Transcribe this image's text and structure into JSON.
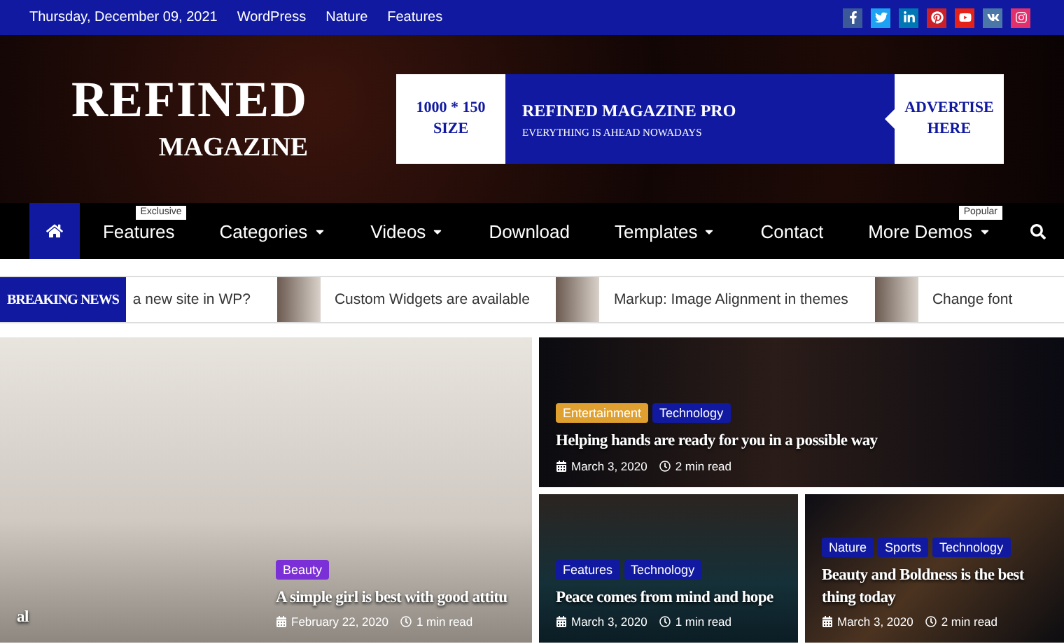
{
  "top_bar": {
    "date": "Thursday, December 09, 2021",
    "links": [
      "WordPress",
      "Nature",
      "Features"
    ],
    "social": [
      {
        "kind": "facebook",
        "color": "#3b5998"
      },
      {
        "kind": "twitter",
        "color": "#1da1f2"
      },
      {
        "kind": "linkedin",
        "color": "#0077b5"
      },
      {
        "kind": "pinterest",
        "color": "#cb2027"
      },
      {
        "kind": "youtube",
        "color": "#e62117"
      },
      {
        "kind": "vk",
        "color": "#4a76a8"
      },
      {
        "kind": "instagram",
        "color": "#e1306c"
      }
    ]
  },
  "logo": {
    "line_1": "REFINED",
    "line_2": "MAGAZINE"
  },
  "ad_banner": {
    "size_lines": [
      "1000 * 150",
      "SIZE"
    ],
    "title": "REFINED MAGAZINE PRO",
    "subtitle": "EVERYTHING IS AHEAD NOWADAYS",
    "cta_lines": [
      "ADVERTISE",
      "HERE"
    ]
  },
  "nav": {
    "items": [
      {
        "kind": "home",
        "selected": true
      },
      {
        "kind": "link",
        "label": "Features",
        "dropdown": false,
        "badge": "Exclusive",
        "selected": false
      },
      {
        "kind": "link",
        "label": "Categories",
        "dropdown": true,
        "selected": false
      },
      {
        "kind": "link",
        "label": "Videos",
        "dropdown": true,
        "selected": false
      },
      {
        "kind": "link",
        "label": "Download",
        "dropdown": false,
        "selected": false
      },
      {
        "kind": "link",
        "label": "Templates",
        "dropdown": true,
        "selected": false
      },
      {
        "kind": "link",
        "label": "Contact",
        "dropdown": false,
        "selected": false
      },
      {
        "kind": "link",
        "label": "More Demos",
        "dropdown": true,
        "badge": "Popular",
        "selected": false
      }
    ]
  },
  "breaking_news": {
    "label": "BREAKING NEWS",
    "items": [
      {
        "title": "a new site in WP?",
        "thumbnail": false
      },
      {
        "title": "Custom Widgets are available",
        "thumbnail": true
      },
      {
        "title": "Markup: Image Alignment in themes",
        "thumbnail": true
      },
      {
        "title": "Change font",
        "thumbnail": true
      }
    ]
  },
  "slider": [
    {
      "title": "al"
    },
    {
      "title": "A simple girl is best with good attitu",
      "tags": [
        {
          "label": "Beauty",
          "color": "#7b2fd6"
        }
      ],
      "date": "February 22, 2020",
      "read_time": "1 min read"
    }
  ],
  "featured": [
    {
      "title": "Helping hands are ready for you in a possible way",
      "tags": [
        {
          "label": "Entertainment",
          "color": "#e0a030"
        },
        {
          "label": "Technology",
          "color": "#1019a0"
        }
      ],
      "date": "March 3, 2020",
      "read_time": "2 min read"
    },
    {
      "title": "Peace comes from mind and hope",
      "tags": [
        {
          "label": "Features",
          "color": "#1019a0"
        },
        {
          "label": "Technology",
          "color": "#1019a0"
        }
      ],
      "date": "March 3, 2020",
      "read_time": "1 min read"
    },
    {
      "title": "Beauty and Boldness is the best thing today",
      "tags": [
        {
          "label": "Nature",
          "color": "#1019a0"
        },
        {
          "label": "Sports",
          "color": "#1019a0"
        },
        {
          "label": "Technology",
          "color": "#1019a0"
        }
      ],
      "date": "March 3, 2020",
      "read_time": "2 min read"
    }
  ]
}
